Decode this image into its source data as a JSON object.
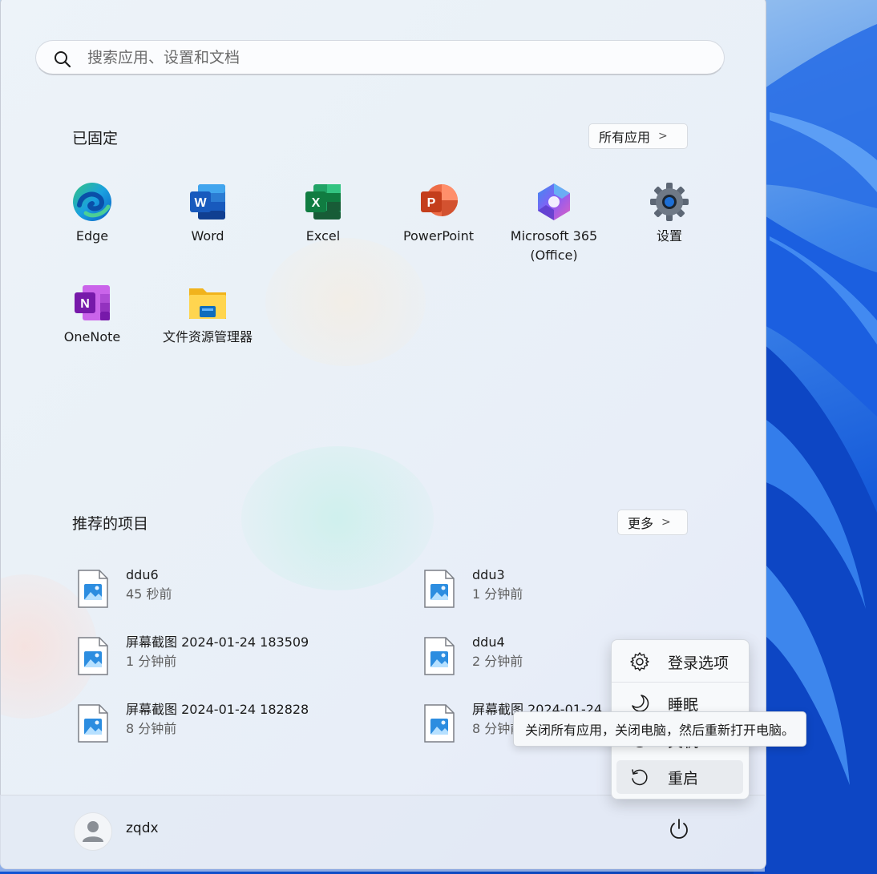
{
  "search": {
    "placeholder": "搜索应用、设置和文档"
  },
  "pinned": {
    "title": "已固定",
    "all_apps_label": "所有应用",
    "apps": [
      {
        "label": "Edge",
        "icon": "edge-icon"
      },
      {
        "label": "Word",
        "icon": "word-icon"
      },
      {
        "label": "Excel",
        "icon": "excel-icon"
      },
      {
        "label": "PowerPoint",
        "icon": "powerpoint-icon"
      },
      {
        "label": "Microsoft 365\n(Office)",
        "icon": "microsoft-365-icon"
      },
      {
        "label": "设置",
        "icon": "settings-gear-icon"
      },
      {
        "label": "OneNote",
        "icon": "onenote-icon"
      },
      {
        "label": "文件资源管理器",
        "icon": "file-explorer-icon"
      }
    ]
  },
  "recommended": {
    "title": "推荐的项目",
    "more_label": "更多",
    "items": [
      {
        "name": "ddu6",
        "time": "45 秒前"
      },
      {
        "name": "ddu3",
        "time": "1 分钟前"
      },
      {
        "name": "屏幕截图 2024-01-24 183509",
        "time": "1 分钟前"
      },
      {
        "name": "ddu4",
        "time": "2 分钟前"
      },
      {
        "name": "屏幕截图 2024-01-24 182828",
        "time": "8 分钟前"
      },
      {
        "name": "屏幕截图 2024-01-24",
        "time": "8 分钟前"
      }
    ]
  },
  "user": {
    "name": "zqdx"
  },
  "power_menu": {
    "signin_options": "登录选项",
    "sleep": "睡眠",
    "shutdown": "关机",
    "restart": "重启"
  },
  "tooltip": {
    "text": "关闭所有应用，关闭电脑，然后重新打开电脑。"
  }
}
